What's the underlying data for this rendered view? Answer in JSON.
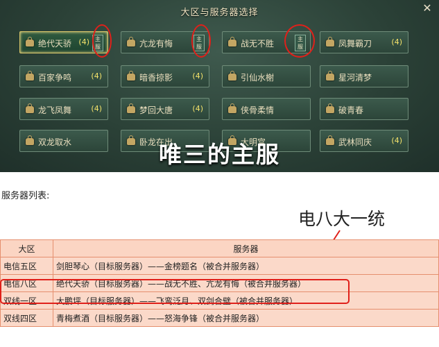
{
  "panel": {
    "title": "大区与服务器选择",
    "close_symbol": "✕",
    "overlay_caption": "唯三的主服",
    "main_tag": "主服",
    "servers": [
      {
        "name": "绝代天骄",
        "count": "(4)",
        "selected": true,
        "main": true
      },
      {
        "name": "亢龙有悔",
        "count": "",
        "selected": false,
        "main": true
      },
      {
        "name": "战无不胜",
        "count": "",
        "selected": false,
        "main": true
      },
      {
        "name": "凤舞霸刀",
        "count": "(4)",
        "selected": false,
        "main": false
      },
      {
        "name": "百家争鸣",
        "count": "(4)",
        "selected": false,
        "main": false
      },
      {
        "name": "暗香掠影",
        "count": "(4)",
        "selected": false,
        "main": false
      },
      {
        "name": "引仙水榭",
        "count": "",
        "selected": false,
        "main": false
      },
      {
        "name": "星河清梦",
        "count": "",
        "selected": false,
        "main": false
      },
      {
        "name": "龙飞凤舞",
        "count": "(4)",
        "selected": false,
        "main": false
      },
      {
        "name": "梦回大唐",
        "count": "(4)",
        "selected": false,
        "main": false
      },
      {
        "name": "侠骨柔情",
        "count": "",
        "selected": false,
        "main": false
      },
      {
        "name": "破青春",
        "count": "",
        "selected": false,
        "main": false
      },
      {
        "name": "双龙取水",
        "count": "",
        "selected": false,
        "main": false
      },
      {
        "name": "卧龙在出",
        "count": "",
        "selected": false,
        "main": false
      },
      {
        "name": "大明宫",
        "count": "",
        "selected": false,
        "main": false
      },
      {
        "name": "武林同庆",
        "count": "(4)",
        "selected": false,
        "main": false
      }
    ]
  },
  "doc": {
    "list_title": "服务器列表:",
    "annotation": "电八大一统",
    "headers": {
      "region": "大区",
      "server": "服务器"
    },
    "rows": [
      {
        "region": "电信五区",
        "server": "剑胆琴心（目标服务器）——金榜题名（被合并服务器）"
      },
      {
        "region": "电信八区",
        "server": "绝代天骄（目标服务器）——战无不胜、亢龙有悔（被合并服务器）"
      },
      {
        "region": "双线一区",
        "server": "大鹏坪（目标服务器）——飞鸾泛月、双剑合璧（被合并服务器）"
      },
      {
        "region": "双线四区",
        "server": "青梅煮酒（目标服务器）——怒海争锋（被合并服务器）"
      }
    ]
  }
}
